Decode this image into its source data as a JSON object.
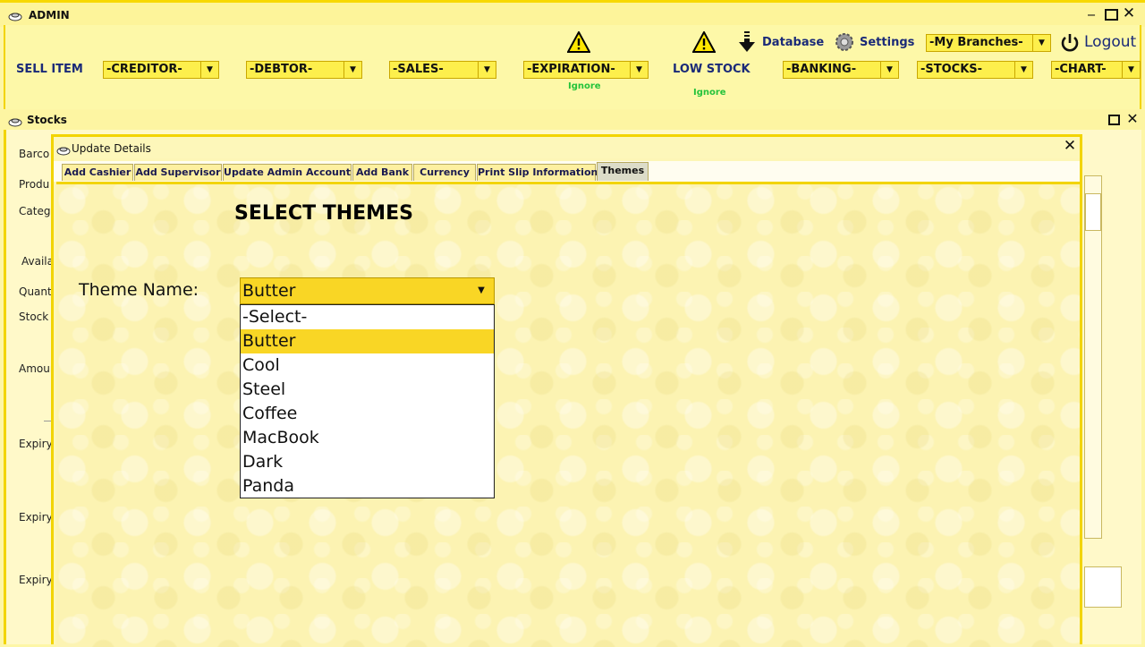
{
  "admin_window": {
    "title": "ADMIN"
  },
  "toolbar": {
    "sell_item": "SELL ITEM",
    "creditor": "-CREDITOR-",
    "debtor": "-DEBTOR-",
    "sales": "-SALES-",
    "expiration": "-EXPIRATION-",
    "expiration_ignore": "Ignore",
    "low_stock": "LOW STOCK",
    "low_stock_ignore": "Ignore",
    "banking": "-BANKING-",
    "stocks": "-STOCKS-",
    "chart": "-CHART-",
    "database": "Database",
    "settings": "Settings",
    "branches": "-My Branches-",
    "logout": "Logout"
  },
  "stocks_window": {
    "title": "Stocks",
    "labels": [
      "Barco",
      "Produ",
      "Categ",
      "Availa",
      "Quant",
      "Stock",
      "Amour",
      "Expiry",
      "Expiry",
      "Expiry"
    ]
  },
  "dialog": {
    "title": "Update Details",
    "tabs": [
      "Add Cashier",
      "Add Supervisor",
      "Update Admin Account",
      "Add Bank",
      "Currency",
      "Print Slip Information",
      "Themes"
    ],
    "active_tab": "Themes",
    "heading": "SELECT THEMES",
    "theme_label": "Theme Name:",
    "theme_selected": "Butter",
    "theme_options": [
      "-Select-",
      "Butter",
      "Cool",
      "Steel",
      "Coffee",
      "MacBook",
      "Dark",
      "Panda"
    ]
  },
  "colors": {
    "accent_yellow": "#f9d625",
    "nav_blue": "#1a2a78",
    "ignore_green": "#25c33b",
    "border_yellow": "#f2d400"
  }
}
